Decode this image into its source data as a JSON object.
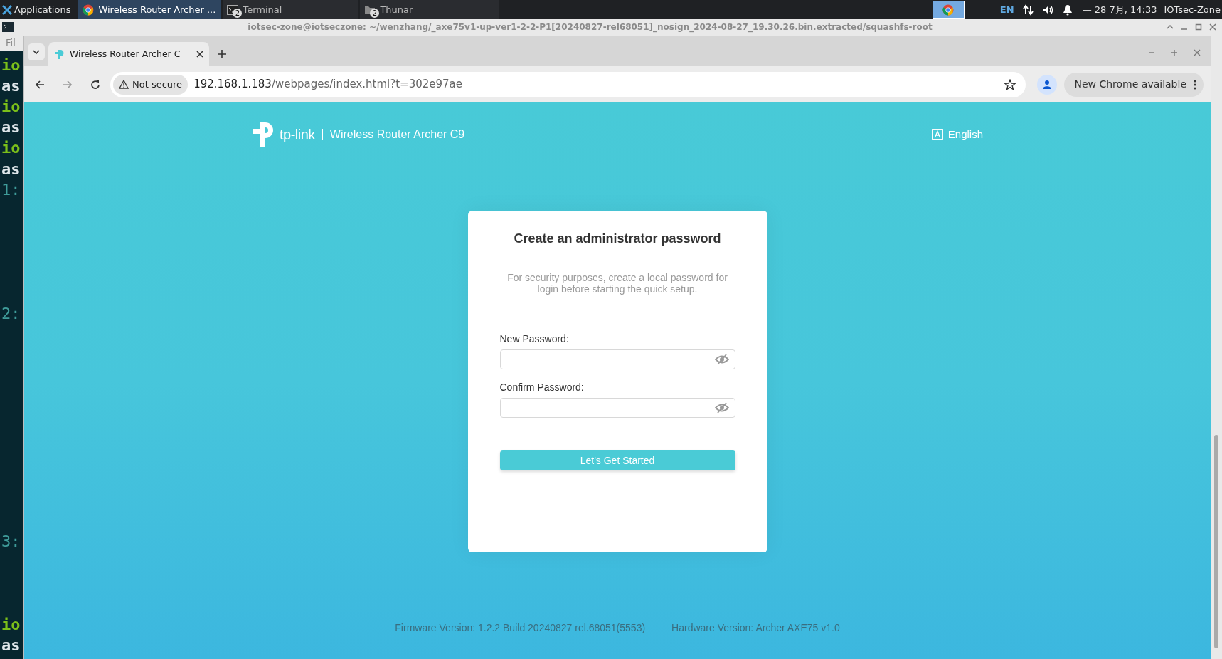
{
  "taskbar": {
    "menu": "Applications",
    "windows": [
      {
        "kind": "browser",
        "title": "Wireless Router Archer ...",
        "selected": true
      },
      {
        "kind": "terminal",
        "title": "Terminal",
        "badge": "2",
        "selected": false
      },
      {
        "kind": "folder",
        "title": "Thunar",
        "badge": "2",
        "selected": false
      }
    ],
    "tray": {
      "language": "EN",
      "clock": "— 28 7月, 14:33",
      "user": "IOTsec-Zone"
    }
  },
  "terminal": {
    "title": "iotsec-zone@iotseczone: ~/wenzhang/_axe75v1-up-ver1-2-2-P1[20240827-rel68051]_nosign_2024-08-27_19.30.26.bin.extracted/squashfs-root",
    "menu": "Fil",
    "lines": [
      {
        "kind": "user",
        "text": "io"
      },
      {
        "kind": "host",
        "text": "as"
      },
      {
        "kind": "user",
        "text": "io"
      },
      {
        "kind": "host",
        "text": "as"
      },
      {
        "kind": "user",
        "text": "io"
      },
      {
        "kind": "host",
        "text": "as"
      },
      {
        "kind": "number",
        "text": "1:"
      },
      {
        "kind": "number",
        "text": "2:"
      },
      {
        "kind": "number",
        "text": "3:"
      },
      {
        "kind": "user",
        "text": "io"
      },
      {
        "kind": "host",
        "text": "as"
      }
    ]
  },
  "browser": {
    "tab": {
      "title": "Wireless Router Archer C"
    },
    "security": "Not secure",
    "url_host": "192.168.1.183",
    "url_path": "/webpages/index.html?t=302e97ae",
    "update": "New Chrome available"
  },
  "page": {
    "brand": "tp-link",
    "product": "Wireless Router Archer C9",
    "language": "English",
    "card": {
      "title": "Create an administrator password",
      "description": "For security purposes, create a local password for login before starting the quick setup.",
      "fields": [
        {
          "label": "New Password:"
        },
        {
          "label": "Confirm Password:"
        }
      ],
      "button": "Let's Get Started"
    },
    "footer": [
      "Firmware Version: 1.2.2 Build 20240827 rel.68051(5553)",
      "Hardware Version: Archer AXE75 v1.0"
    ]
  }
}
